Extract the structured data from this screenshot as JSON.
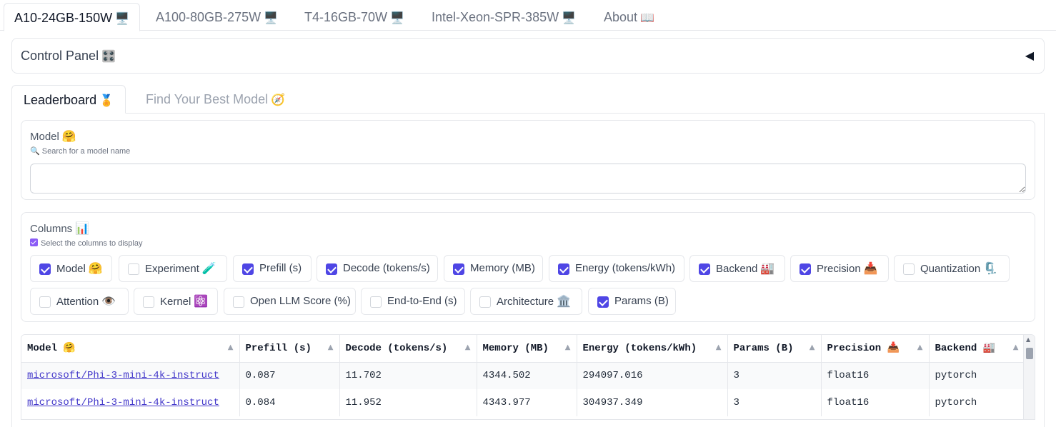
{
  "top_tabs": [
    {
      "label": "A10-24GB-150W",
      "icon": "🖥️",
      "active": true
    },
    {
      "label": "A100-80GB-275W",
      "icon": "🖥️",
      "active": false
    },
    {
      "label": "T4-16GB-70W",
      "icon": "🖥️",
      "active": false
    },
    {
      "label": "Intel-Xeon-SPR-385W",
      "icon": "🖥️",
      "active": false
    },
    {
      "label": "About",
      "icon": "📖",
      "active": false
    }
  ],
  "control_panel": {
    "title": "Control Panel",
    "icon": "🎛️",
    "toggle": "◀"
  },
  "sub_tabs": [
    {
      "label": "Leaderboard",
      "icon": "🏅",
      "active": true
    },
    {
      "label": "Find Your Best Model",
      "icon": "🧭",
      "active": false
    }
  ],
  "model_filter": {
    "label": "Model",
    "icon": "🤗",
    "info": "🔍 Search for a model name",
    "value": ""
  },
  "columns_filter": {
    "label": "Columns",
    "icon": "📊",
    "info": "Select the columns to display",
    "options": [
      {
        "label": "Model",
        "icon": "🤗",
        "checked": true
      },
      {
        "label": "Experiment",
        "icon": "🧪",
        "checked": false
      },
      {
        "label": "Prefill (s)",
        "icon": "",
        "checked": true
      },
      {
        "label": "Decode (tokens/s)",
        "icon": "",
        "checked": true
      },
      {
        "label": "Memory (MB)",
        "icon": "",
        "checked": true
      },
      {
        "label": "Energy (tokens/kWh)",
        "icon": "",
        "checked": true
      },
      {
        "label": "Backend",
        "icon": "🏭",
        "checked": true
      },
      {
        "label": "Precision",
        "icon": "📥",
        "checked": true
      },
      {
        "label": "Quantization",
        "icon": "🗜️",
        "checked": false
      },
      {
        "label": "Attention",
        "icon": "👁️",
        "checked": false
      },
      {
        "label": "Kernel",
        "icon": "⚛️",
        "checked": false
      },
      {
        "label": "Open LLM Score (%)",
        "icon": "",
        "checked": false
      },
      {
        "label": "End-to-End (s)",
        "icon": "",
        "checked": false
      },
      {
        "label": "Architecture",
        "icon": "🏛️",
        "checked": false
      },
      {
        "label": "Params (B)",
        "icon": "",
        "checked": true
      }
    ]
  },
  "table": {
    "headers": [
      "Model 🤗",
      "Prefill (s)",
      "Decode (tokens/s)",
      "Memory (MB)",
      "Energy (tokens/kWh)",
      "Params (B)",
      "Precision 📥",
      "Backend 🏭"
    ],
    "sort_glyph": "▲",
    "rows": [
      [
        "microsoft/Phi-3-mini-4k-instruct",
        "0.087",
        "11.702",
        "4344.502",
        "294097.016",
        "3",
        "float16",
        "pytorch"
      ],
      [
        "microsoft/Phi-3-mini-4k-instruct",
        "0.084",
        "11.952",
        "4343.977",
        "304937.349",
        "3",
        "float16",
        "pytorch"
      ]
    ]
  },
  "colors": {
    "accent": "#4f46e5",
    "link": "#4338ca",
    "border": "#e5e7eb"
  }
}
